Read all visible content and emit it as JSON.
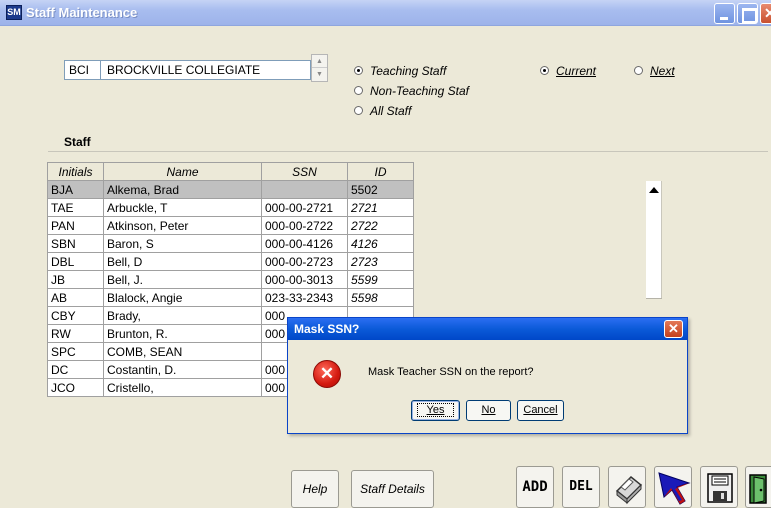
{
  "window": {
    "title": "Staff Maintenance",
    "app_icon": "SM"
  },
  "school": {
    "code": "BCI",
    "name": "BROCKVILLE COLLEGIATE"
  },
  "staff_type": {
    "options": [
      {
        "label": "Teaching Staff",
        "selected": true
      },
      {
        "label": "Non-Teaching Staf",
        "selected": false
      },
      {
        "label": "All Staff",
        "selected": false
      }
    ]
  },
  "period": {
    "current": {
      "label": "Current",
      "selected": true
    },
    "next": {
      "label": "Next",
      "selected": false
    }
  },
  "staff_section": {
    "label": "Staff"
  },
  "grid": {
    "columns": [
      "Initials",
      "Name",
      "SSN",
      "ID"
    ],
    "rows": [
      {
        "initials": "BJA",
        "name": "Alkema, Brad",
        "ssn": "",
        "id": "5502",
        "selected": true
      },
      {
        "initials": "TAE",
        "name": "Arbuckle, T",
        "ssn": "000-00-2721",
        "id": "2721"
      },
      {
        "initials": "PAN",
        "name": "Atkinson, Peter",
        "ssn": "000-00-2722",
        "id": "2722"
      },
      {
        "initials": "SBN",
        "name": "Baron, S",
        "ssn": "000-00-4126",
        "id": "4126"
      },
      {
        "initials": "DBL",
        "name": "Bell, D",
        "ssn": "000-00-2723",
        "id": "2723"
      },
      {
        "initials": "JB",
        "name": "Bell, J.",
        "ssn": "000-00-3013",
        "id": "5599"
      },
      {
        "initials": "AB",
        "name": "Blalock, Angie",
        "ssn": "023-33-2343",
        "id": "5598"
      },
      {
        "initials": "CBY",
        "name": "Brady,",
        "ssn": "000",
        "id": ""
      },
      {
        "initials": "RW",
        "name": "Brunton, R.",
        "ssn": "000",
        "id": ""
      },
      {
        "initials": "SPC",
        "name": "COMB, SEAN",
        "ssn": "",
        "id": ""
      },
      {
        "initials": "DC",
        "name": "Costantin, D.",
        "ssn": "000",
        "id": ""
      },
      {
        "initials": "JCO",
        "name": "Cristello,",
        "ssn": "000",
        "id": ""
      }
    ]
  },
  "dialog": {
    "title": "Mask SSN?",
    "message": "Mask Teacher SSN on the report?",
    "yes": "Yes",
    "no": "No",
    "cancel": "Cancel",
    "close": "✕",
    "error_glyph": "✕"
  },
  "buttons": {
    "help": "Help",
    "staff_details": "Staff Details",
    "add": "ADD",
    "del": "DEL"
  },
  "icons": {
    "print": "printer-icon",
    "pointer": "cursor-arrow-icon",
    "save": "floppy-save-icon",
    "exit": "exit-door-icon"
  }
}
